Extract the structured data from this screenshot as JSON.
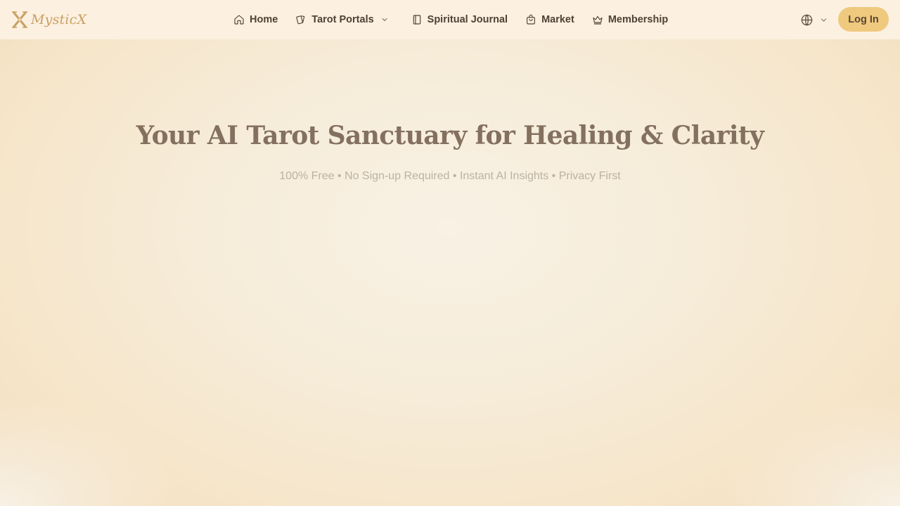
{
  "brand": {
    "name": "MysticX"
  },
  "nav": {
    "items": [
      {
        "label": "Home",
        "icon": "home-icon"
      },
      {
        "label": "Tarot Portals",
        "icon": "cards-icon",
        "has_dropdown": true
      },
      {
        "label": "Spiritual Journal",
        "icon": "book-icon"
      },
      {
        "label": "Market",
        "icon": "shopping-bag-icon"
      },
      {
        "label": "Membership",
        "icon": "crown-icon"
      }
    ]
  },
  "header": {
    "language_icon": "globe-icon",
    "login_label": "Log In"
  },
  "hero": {
    "title": "Your AI Tarot Sanctuary for Healing & Clarity",
    "subtitle": "100% Free • No Sign-up Required • Instant AI Insights • Privacy First"
  },
  "colors": {
    "header_bg": "#fcf0e0",
    "accent": "#efc97e",
    "brand_gold": "#c9a064",
    "title": "#84705f",
    "subtitle": "#bcb1a4"
  }
}
